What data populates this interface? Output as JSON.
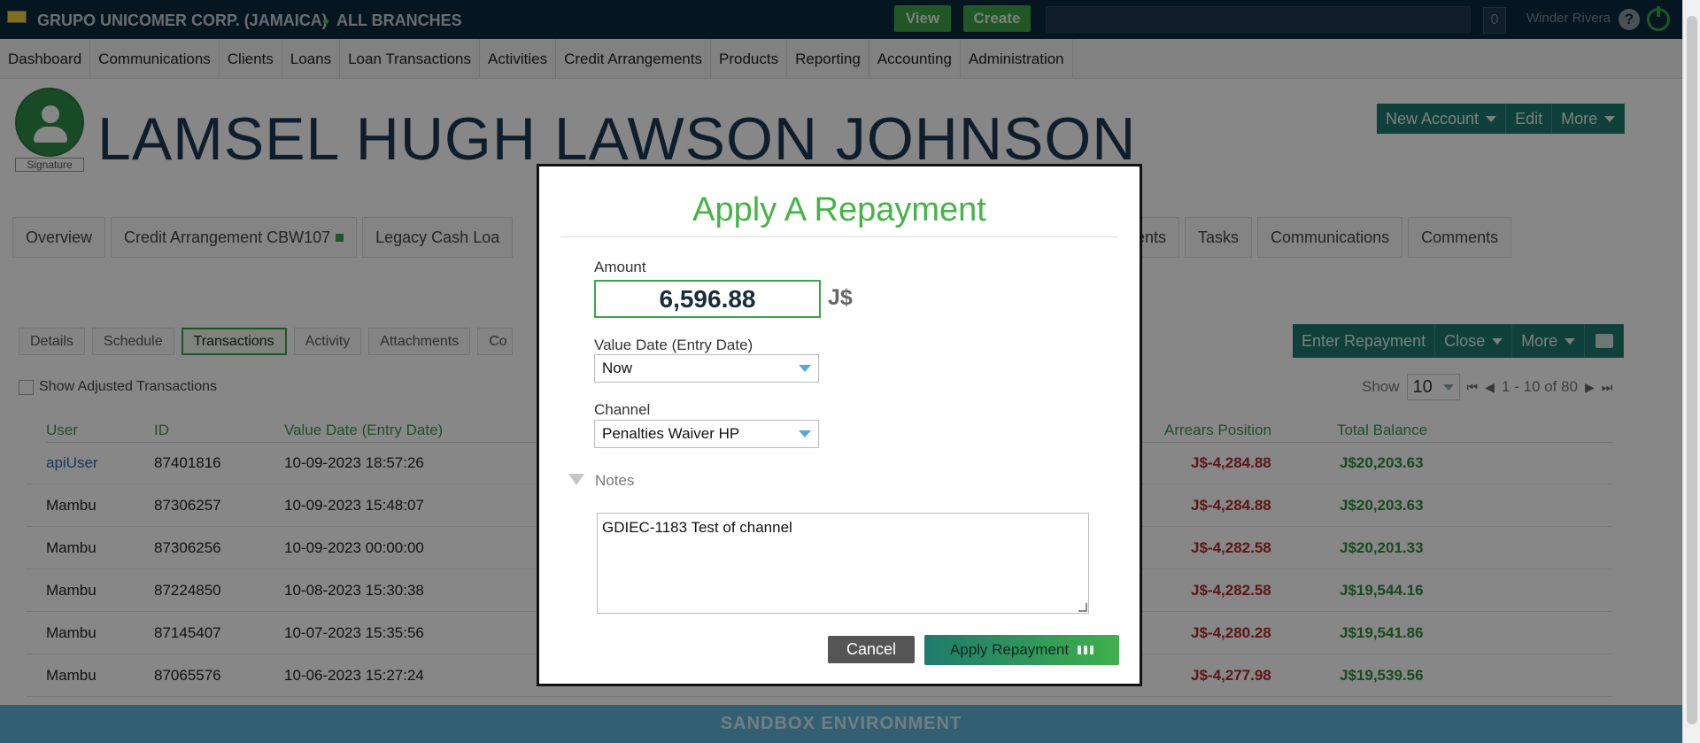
{
  "topbar": {
    "org": "GRUPO UNICOMER CORP. (JAMAICA)",
    "branches": "ALL BRANCHES",
    "view_label": "View",
    "create_label": "Create",
    "notifications_count": "0",
    "user_name": "Winder Rivera",
    "help_glyph": "?"
  },
  "nav": [
    "Dashboard",
    "Communications",
    "Clients",
    "Loans",
    "Loan Transactions",
    "Activities",
    "Credit Arrangements",
    "Products",
    "Reporting",
    "Accounting",
    "Administration"
  ],
  "client": {
    "signature_label": "Signature",
    "name": "LAMSEL HUGH LAWSON JOHNSON"
  },
  "account_actions": {
    "new_account": "New Account",
    "edit": "Edit",
    "more": "More"
  },
  "account_tabs": [
    "Overview",
    "Credit Arrangement CBW107",
    "Legacy Cash Loa",
    "ments",
    "Tasks",
    "Communications",
    "Comments"
  ],
  "sub_tabs": [
    "Details",
    "Schedule",
    "Transactions",
    "Activity",
    "Attachments",
    "Co"
  ],
  "tx_actions": {
    "enter_repayment": "Enter Repayment",
    "close": "Close",
    "more": "More"
  },
  "show_adjusted_label": "Show Adjusted Transactions",
  "pager": {
    "show_label": "Show",
    "page_size": "10",
    "range": "1 - 10 of 80"
  },
  "table": {
    "headers": {
      "user": "User",
      "id": "ID",
      "value_date": "Value Date (Entry Date)",
      "arrears": "Arrears Position",
      "total": "Total Balance"
    },
    "rows": [
      {
        "user": "apiUser",
        "id": "87401816",
        "date": "10-09-2023 18:57:26",
        "arrears": "J$-4,284.88",
        "total": "J$20,203.63"
      },
      {
        "user": "Mambu",
        "id": "87306257",
        "date": "10-09-2023 15:48:07",
        "arrears": "J$-4,284.88",
        "total": "J$20,203.63"
      },
      {
        "user": "Mambu",
        "id": "87306256",
        "date": "10-09-2023 00:00:00",
        "arrears": "J$-4,282.58",
        "total": "J$20,201.33"
      },
      {
        "user": "Mambu",
        "id": "87224850",
        "date": "10-08-2023 15:30:38",
        "arrears": "J$-4,282.58",
        "total": "J$19,544.16"
      },
      {
        "user": "Mambu",
        "id": "87145407",
        "date": "10-07-2023 15:35:56",
        "arrears": "J$-4,280.28",
        "total": "J$19,541.86"
      },
      {
        "user": "Mambu",
        "id": "87065576",
        "date": "10-06-2023 15:27:24",
        "arrears": "J$-4,277.98",
        "total": "J$19,539.56"
      }
    ]
  },
  "sandbox_label": "SANDBOX ENVIRONMENT",
  "modal": {
    "title": "Apply A Repayment",
    "amount_label": "Amount",
    "amount_value": "6,596.88",
    "currency": "J$",
    "value_date_label": "Value Date (Entry Date)",
    "value_date_selected": "Now",
    "channel_label": "Channel",
    "channel_selected": "Penalties Waiver HP",
    "notes_label": "Notes",
    "notes_value": "GDIEC-1183 Test of channel",
    "cancel_label": "Cancel",
    "apply_label": "Apply Repayment"
  },
  "colors": {
    "topbar": "#0c2a3e",
    "accent_green": "#46b347",
    "action_teal": "#1f7a6e",
    "negative": "#b02b2b",
    "positive": "#2e8b3a",
    "sandbox": "#5fb6d8"
  }
}
